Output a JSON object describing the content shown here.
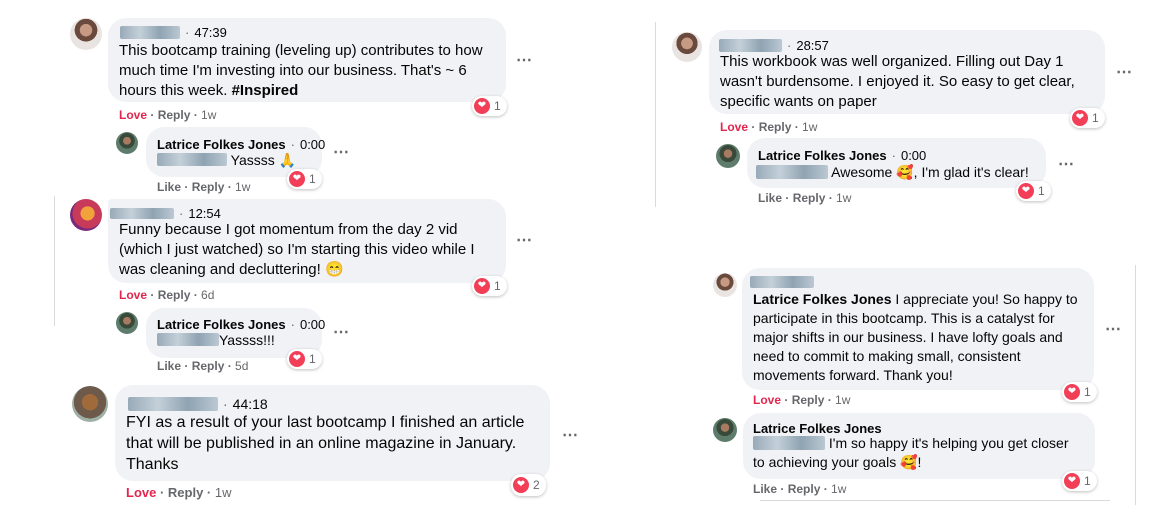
{
  "icons": {
    "more": "⋯",
    "heart": "❤"
  },
  "actions": {
    "love": "Love",
    "reply": "Reply",
    "like": "Like",
    "sep": " · "
  },
  "reply_author": "Latrice Folkes Jones",
  "left": {
    "c1": {
      "time": "47:39",
      "text": [
        "This bootcamp training (leveling up) contributes to how",
        "much time I'm investing into our business. That's ~ 6",
        "hours this week. "
      ],
      "hashtag": "#Inspired",
      "age": "1w",
      "reactions": "1",
      "reply": {
        "time": "0:00",
        "text": "Yassss",
        "emoji": "🙏",
        "age": "1w",
        "reactions": "1"
      }
    },
    "c2": {
      "time": "12:54",
      "text": [
        "Funny because I got momentum from the day 2 vid",
        "(which I just watched) so I'm starting this video while I",
        "was cleaning and decluttering! "
      ],
      "emoji": "😁",
      "age": "6d",
      "reactions": "1",
      "reply": {
        "time": "0:00",
        "text": "Yassss!!!",
        "age": "5d",
        "reactions": "1"
      }
    },
    "c3": {
      "time": "44:18",
      "text": [
        "FYI as a result of your last bootcamp I finished an article",
        "that will be published in an online magazine in January.",
        "Thanks"
      ],
      "age": "1w",
      "reactions": "2"
    }
  },
  "right": {
    "c4": {
      "time": "28:57",
      "text": [
        "This workbook was well organized. Filling out Day 1",
        "wasn't burdensome. I enjoyed it. So easy to get clear,",
        "specific wants on paper"
      ],
      "age": "1w",
      "reactions": "1",
      "reply": {
        "time": "0:00",
        "text_a": "Awesome ",
        "emoji": "🥰",
        "text_b": ", I'm glad it's clear!",
        "age": "1w",
        "reactions": "1"
      }
    },
    "c5": {
      "mention": "Latrice Folkes Jones",
      "text": [
        " I appreciate you! So happy to",
        "participate in this bootcamp. This is a catalyst for",
        "major shifts in our business. I have lofty goals and",
        "need to commit to making small, consistent",
        "movements forward. Thank you!"
      ],
      "age": "1w",
      "reactions": "1",
      "reply": {
        "text_a": " I'm so happy it's helping you get closer",
        "text_b": "to achieving your goals ",
        "emoji": "🥰",
        "text_c": "!",
        "age": "1w",
        "reactions": "1"
      }
    }
  }
}
